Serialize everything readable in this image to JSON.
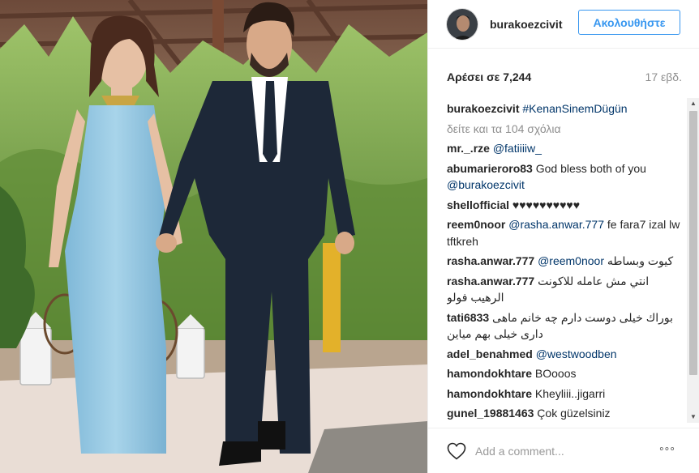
{
  "post": {
    "username": "burakoezcivit",
    "follow_label": "Ακολουθήστε",
    "likes": "Αρέσει σε 7,244",
    "timestamp": "17 εβδ.",
    "add_comment_placeholder": "Add a comment...",
    "more_label": "◦◦◦"
  },
  "comments": [
    {
      "user": "burakoezcivit",
      "mention": "#KenanSinemDügün",
      "text": ""
    },
    {
      "user": "",
      "view_all": "δείτε και τα 104 σχόλια"
    },
    {
      "user": "mr._.rze",
      "mention": "@fatiiiiw_",
      "text": ""
    },
    {
      "user": "abumarieroro83",
      "text": "God bless both of you",
      "mention_after": "@burakoezcivit"
    },
    {
      "user": "shellofficial",
      "text": "♥♥♥♥♥♥♥♥♥♥"
    },
    {
      "user": "reem0noor",
      "mention": "@rasha.anwar.777",
      "text": "fe fara7 izal lw tftkreh"
    },
    {
      "user": "rasha.anwar.777",
      "mention": "@reem0noor",
      "text": "كيوت وبساطه"
    },
    {
      "user": "rasha.anwar.777",
      "text": "انتي مش عامله للاكونت الرهيب فولو"
    },
    {
      "user": "tati6833",
      "text": "بوراك خیلی دوست دارم چه خانم ماهی داری خیلی بهم میاین"
    },
    {
      "user": "adel_benahmed",
      "mention": "@westwoodben",
      "text": ""
    },
    {
      "user": "hamondokhtare",
      "text": "BOooos"
    },
    {
      "user": "hamondokhtare",
      "text": "Kheyliii..jigarri"
    },
    {
      "user": "gunel_19881463",
      "text": "Çok güzelsiniz"
    }
  ],
  "colors": {
    "accent_blue": "#3897f0",
    "mention": "#003569",
    "muted": "#8e8e8e"
  },
  "icons": {
    "like": "heart-outline-icon",
    "more": "more-options-icon"
  }
}
